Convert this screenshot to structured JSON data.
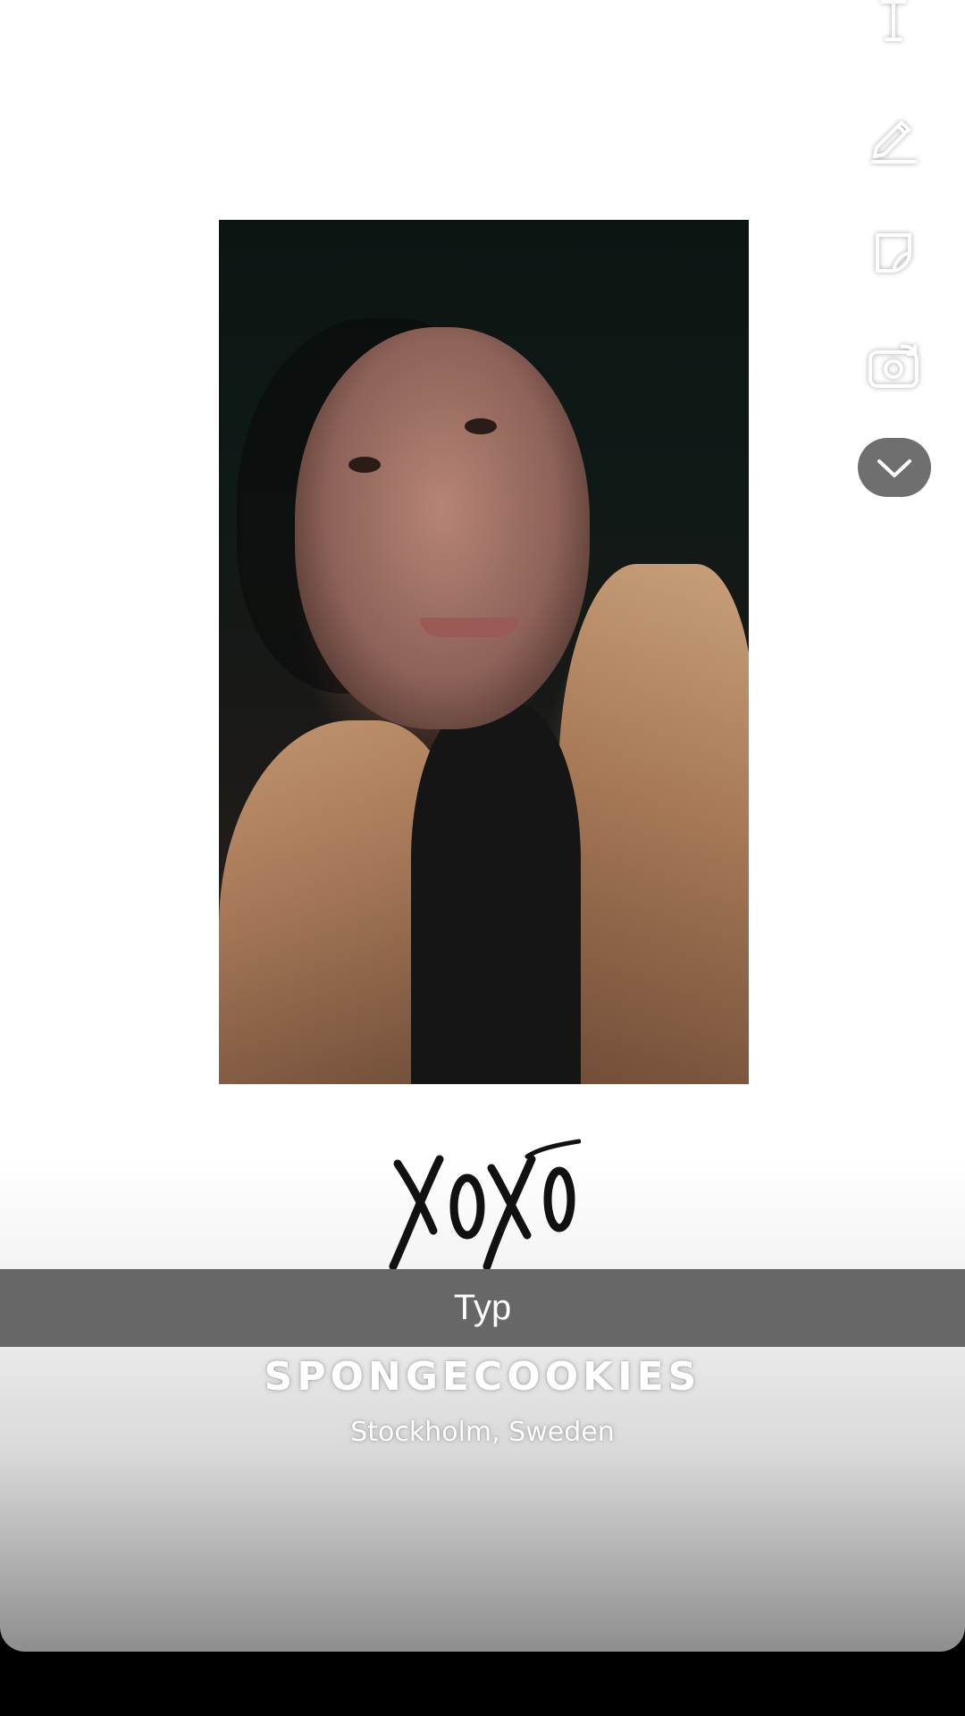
{
  "photo": {
    "description": ""
  },
  "sticker": {
    "text": "XOXO"
  },
  "caption": {
    "text": "Typ"
  },
  "profile": {
    "username": "SPONGECOOKIES",
    "location": "Stockholm, Sweden"
  },
  "toolbar": {
    "icons": [
      "text-tool-icon",
      "pencil-icon",
      "sticker-icon",
      "flip-camera-icon",
      "chevron-down-icon"
    ]
  },
  "colors": {
    "caption_bar": "#676767",
    "chevron_button": "#6f6f6f"
  }
}
